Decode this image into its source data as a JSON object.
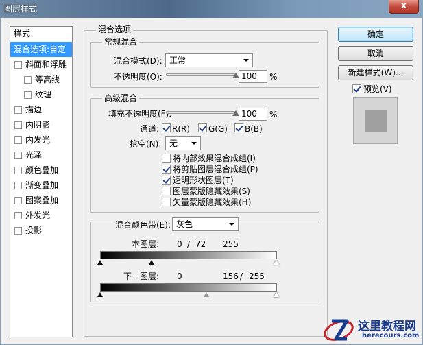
{
  "window": {
    "title": "图层样式",
    "close_glyph": "x"
  },
  "left_panel": {
    "header": "样式",
    "items": [
      {
        "label": "混合选项:自定",
        "selected": true
      },
      {
        "label": "斜面和浮雕",
        "checked": false
      },
      {
        "label": "等高线",
        "checked": false,
        "sub": true
      },
      {
        "label": "纹理",
        "checked": false,
        "sub": true
      },
      {
        "label": "描边",
        "checked": false
      },
      {
        "label": "内阴影",
        "checked": false
      },
      {
        "label": "内发光",
        "checked": false
      },
      {
        "label": "光泽",
        "checked": false
      },
      {
        "label": "颜色叠加",
        "checked": false
      },
      {
        "label": "渐变叠加",
        "checked": false
      },
      {
        "label": "图案叠加",
        "checked": false
      },
      {
        "label": "外发光",
        "checked": false
      },
      {
        "label": "投影",
        "checked": false
      }
    ]
  },
  "blending": {
    "section_title": "混合选项",
    "general": {
      "title": "常规混合",
      "mode_label": "混合模式(D):",
      "mode_value": "正常",
      "opacity_label": "不透明度(O):",
      "opacity_value": "100",
      "opacity_unit": "%",
      "opacity_fraction": 1.0
    },
    "advanced": {
      "title": "高级混合",
      "fill_label": "填充不透明度(F):",
      "fill_value": "100",
      "fill_unit": "%",
      "fill_fraction": 1.0,
      "channels_label": "通道:",
      "channel_r": "R(R)",
      "channel_g": "G(G)",
      "channel_b": "B(B)",
      "knockout_label": "挖空(N):",
      "knockout_value": "无",
      "options": [
        {
          "label": "将内部效果混合成组(I)",
          "checked": false
        },
        {
          "label": "将剪贴图层混合成组(P)",
          "checked": true
        },
        {
          "label": "透明形状图层(T)",
          "checked": true
        },
        {
          "label": "图层蒙版隐藏效果(S)",
          "checked": false
        },
        {
          "label": "矢量蒙版隐藏效果(H)",
          "checked": false
        }
      ]
    },
    "blend_if": {
      "label": "混合颜色带(E):",
      "value": "灰色",
      "this_layer_label": "本图层:",
      "this_layer_values": [
        "0",
        "/",
        "72",
        "255"
      ],
      "under_layer_label": "下一图层:",
      "under_layer_values": [
        "0",
        "156",
        "/",
        "255"
      ]
    }
  },
  "buttons": {
    "ok": "确定",
    "cancel": "取消",
    "new_style": "新建样式(W)...",
    "preview_label": "预览(V)",
    "preview_checked": true
  },
  "watermark": {
    "title": "这里教程网",
    "url": "herecours.com"
  },
  "colors": {
    "selection": "#3399ff",
    "title_bar": "#4d6a8a",
    "logo_blue": "#1a3a8c",
    "logo_red": "#c8202a"
  }
}
